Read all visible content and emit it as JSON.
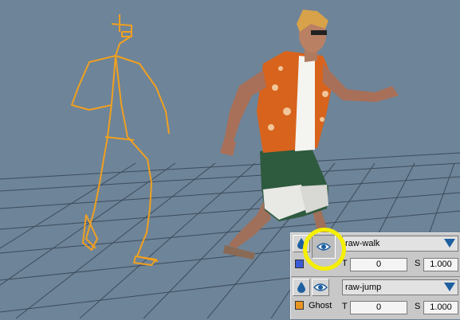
{
  "colors": {
    "viewport_bg": "#6e8498",
    "grid_line": "#3c4c5c",
    "skeleton": "#f0a020",
    "track1_swatch": "#3b5bd6",
    "track2_swatch": "#e89420",
    "highlight": "#f5ef00",
    "dropdown_arrow": "#1e5fa0"
  },
  "tracks": [
    {
      "clip_name": "raw-walk",
      "t_label": "T",
      "t_value": "0",
      "s_label": "S",
      "s_value": "1.000",
      "ghost_visible_pressed": true,
      "swatch_color": "#3b5bd6"
    },
    {
      "clip_name": "raw-jump",
      "t_label": "T",
      "t_value": "0",
      "s_label": "S",
      "s_value": "1.000",
      "ghost_visible_pressed": false,
      "ghost_label": "Ghost",
      "swatch_color": "#e89420"
    }
  ],
  "icons": {
    "source_icon": "water-drop-icon",
    "ghost_icon": "eye-icon",
    "dropdown_icon": "triangle-down-icon"
  }
}
